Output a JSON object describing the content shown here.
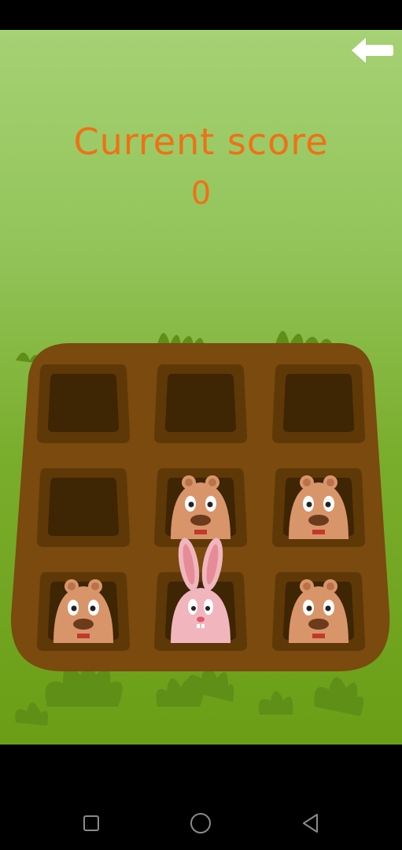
{
  "header": {
    "score_label": "Current score",
    "score_value": "0"
  },
  "controls": {
    "back_icon": "arrow-left-icon"
  },
  "board": {
    "rows": 3,
    "cols": 3,
    "holes": [
      {
        "row": 1,
        "col": 1,
        "occupant": "empty"
      },
      {
        "row": 1,
        "col": 2,
        "occupant": "empty"
      },
      {
        "row": 1,
        "col": 3,
        "occupant": "empty"
      },
      {
        "row": 2,
        "col": 1,
        "occupant": "empty"
      },
      {
        "row": 2,
        "col": 2,
        "occupant": "mole"
      },
      {
        "row": 2,
        "col": 3,
        "occupant": "mole"
      },
      {
        "row": 3,
        "col": 1,
        "occupant": "mole"
      },
      {
        "row": 3,
        "col": 2,
        "occupant": "bunny"
      },
      {
        "row": 3,
        "col": 3,
        "occupant": "mole"
      }
    ]
  },
  "colors": {
    "score_text": "#f07016",
    "board_dirt": "#7a4a0e",
    "hole_rim": "#5f3808",
    "hole_inside": "#3e2504",
    "mole_fur": "#d9956a",
    "bunny_fur": "#f1b6bd",
    "grass": "#5f8f17"
  },
  "system_nav": {
    "recents_icon": "square-icon",
    "home_icon": "circle-icon",
    "back_icon": "triangle-back-icon"
  }
}
